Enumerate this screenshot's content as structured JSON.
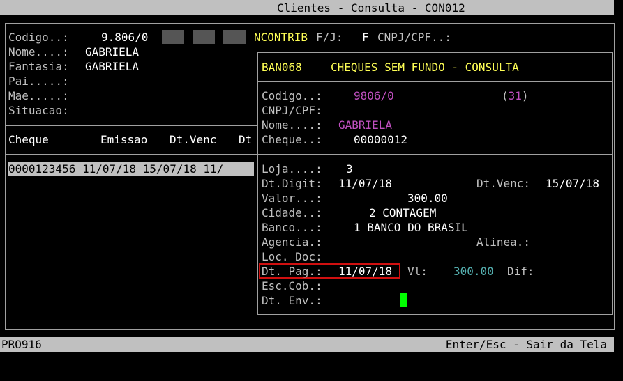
{
  "window": {
    "title": "Clientes - Consulta - CON012"
  },
  "client": {
    "codigo_label": "Codigo..:",
    "codigo_value": "9.806/0",
    "ncontrib_label": "NCONTRIB",
    "fj_label": "F/J:",
    "fj_value": "F",
    "cnpj_label": "CNPJ/CPF..:",
    "nome_label": "Nome....:",
    "nome_value": "GABRIELA",
    "fantasia_label": "Fantasia:",
    "fantasia_value": "GABRIELA",
    "pai_label": "Pai.....:",
    "mae_label": "Mae.....:",
    "situacao_label": "Situacao:"
  },
  "cheques_table": {
    "headers": [
      "Cheque",
      "Emissao",
      "Dt.Venc",
      "Dt"
    ],
    "rows": [
      {
        "text": "0000123456 11/07/18 15/07/18 11/"
      }
    ]
  },
  "popup": {
    "code": "BAN068",
    "title": "CHEQUES SEM FUNDO - CONSULTA",
    "codigo_label": "Codigo..:",
    "codigo_value": "9806/0",
    "count": "31",
    "cnpj_label": "CNPJ/CPF:",
    "nome_label": "Nome....:",
    "nome_value": "GABRIELA",
    "cheque_label": "Cheque..:",
    "cheque_value": "00000012",
    "loja_label": "Loja....:",
    "loja_value": "3",
    "dtdigit_label": "Dt.Digit:",
    "dtdigit_value": "11/07/18",
    "dtvenc_label": "Dt.Venc:",
    "dtvenc_value": "15/07/18",
    "valor_label": "Valor...:",
    "valor_value": "300.00",
    "cidade_label": "Cidade..:",
    "cidade_value": "2 CONTAGEM",
    "banco_label": "Banco...:",
    "banco_value": "1 BANCO DO BRASIL",
    "agencia_label": "Agencia.:",
    "alinea_label": "Alinea.:",
    "locdoc_label": "Loc. Doc:",
    "dtpag_label": "Dt. Pag.:",
    "dtpag_value": "11/07/18",
    "vl_label": "Vl:",
    "vl_value": "300.00",
    "dif_label": "Dif:",
    "esccob_label": "Esc.Cob.:",
    "dtenv_label": "Dt. Env.:"
  },
  "status": {
    "program": "PRO916",
    "hint": "Enter/Esc - Sair da Tela"
  }
}
